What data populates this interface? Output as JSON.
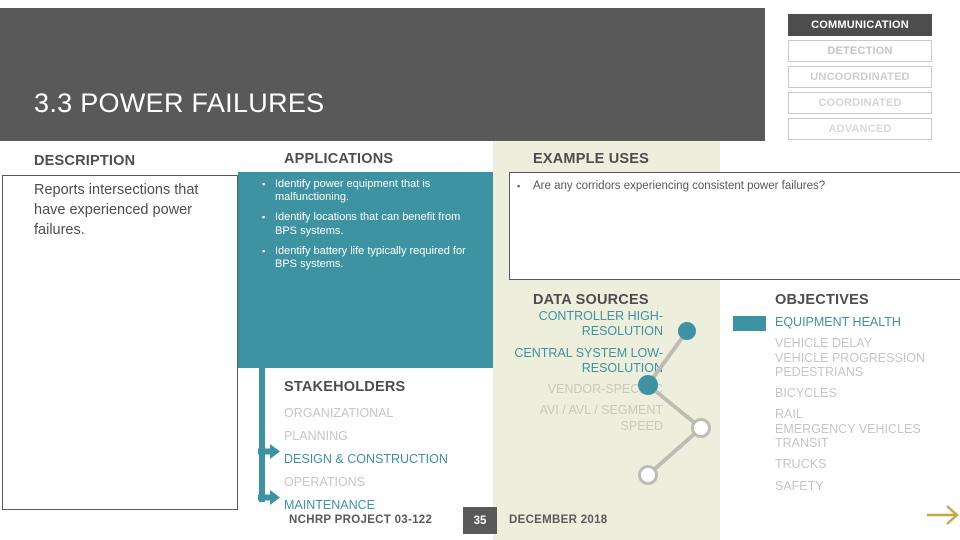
{
  "slide": {
    "title": "3.3 POWER FAILURES",
    "accent_color": "#3d93a1",
    "header_color": "#595959",
    "panel_color": "#eeeedc",
    "arrow_color": "#c4a747"
  },
  "tags": [
    {
      "label": "COMMUNICATION",
      "state": "active"
    },
    {
      "label": "DETECTION",
      "state": "inactive"
    },
    {
      "label": "UNCOORDINATED",
      "state": "inactive"
    },
    {
      "label": "COORDINATED",
      "state": "inactive"
    },
    {
      "label": "ADVANCED",
      "state": "inactive"
    }
  ],
  "headings": {
    "description": "DESCRIPTION",
    "applications": "APPLICATIONS",
    "example_uses": "EXAMPLE USES",
    "data_sources": "DATA SOURCES",
    "objectives": "OBJECTIVES",
    "stakeholders": "STAKEHOLDERS"
  },
  "description": {
    "text": "Reports intersections that have experienced power failures."
  },
  "applications": {
    "bullet": "▪",
    "items": [
      "Identify power equipment that is malfunctioning.",
      "Identify locations that can benefit from BPS systems.",
      "Identify battery life typically required for BPS systems."
    ]
  },
  "example_uses": {
    "bullet": "▪",
    "items": [
      "Are any corridors experiencing consistent power failures?"
    ]
  },
  "data_sources": {
    "items": [
      {
        "label": "CONTROLLER HIGH-RESOLUTION",
        "state": "on"
      },
      {
        "label": "CENTRAL SYSTEM LOW-RESOLUTION",
        "state": "on"
      },
      {
        "label": "VENDOR-SPECIFIC",
        "state": "off"
      },
      {
        "label": "AVI / AVL / SEGMENT SPEED",
        "state": "off"
      }
    ]
  },
  "objectives": {
    "items": [
      {
        "label": "EQUIPMENT HEALTH",
        "state": "on"
      },
      {
        "label": "VEHICLE DELAY",
        "state": "off"
      },
      {
        "label": "VEHICLE PROGRESSION",
        "state": "off"
      },
      {
        "label": "PEDESTRIANS",
        "state": "off"
      },
      {
        "label": "BICYCLES",
        "state": "off"
      },
      {
        "label": "RAIL",
        "state": "off"
      },
      {
        "label": "EMERGENCY VEHICLES",
        "state": "off"
      },
      {
        "label": "TRANSIT",
        "state": "off"
      },
      {
        "label": "TRUCKS",
        "state": "off"
      },
      {
        "label": "SAFETY",
        "state": "off"
      }
    ]
  },
  "stakeholders": {
    "items": [
      {
        "label": "ORGANIZATIONAL",
        "state": "off"
      },
      {
        "label": "PLANNING",
        "state": "off"
      },
      {
        "label": "DESIGN & CONSTRUCTION",
        "state": "on"
      },
      {
        "label": "OPERATIONS",
        "state": "off"
      },
      {
        "label": "MAINTENANCE",
        "state": "on"
      }
    ]
  },
  "footer": {
    "project": "NCHRP PROJECT 03-122",
    "page": "35",
    "date": "DECEMBER 2018"
  }
}
